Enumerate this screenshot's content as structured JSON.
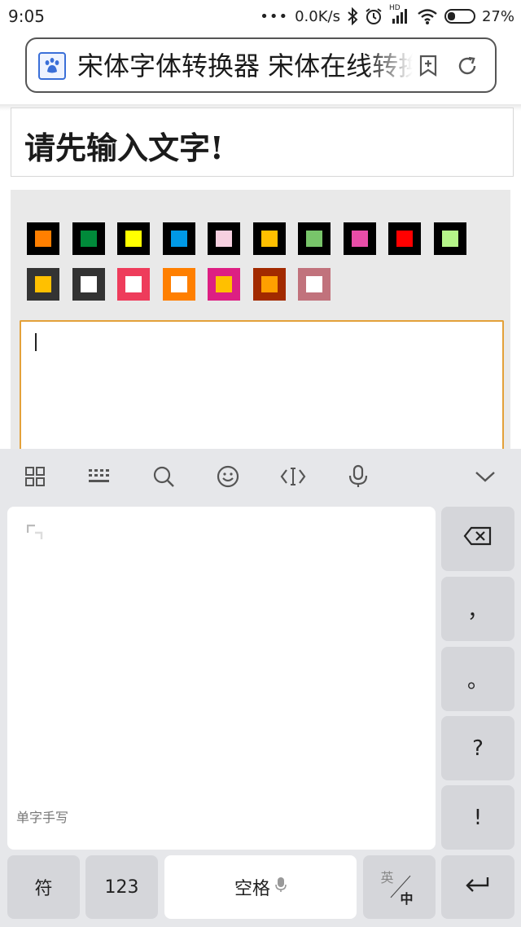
{
  "status_bar": {
    "time": "9:05",
    "network_speed": "0.0K/s",
    "battery_percent": "27%",
    "hd_label": "HD",
    "battery_level": 0.27
  },
  "browser": {
    "page_title": "宋体字体转换器 宋体在线转换器",
    "icons": [
      "paw-icon",
      "bookmark-add-icon",
      "refresh-icon"
    ]
  },
  "page": {
    "notice": "请先输入文字!",
    "swatches": [
      {
        "border": "#000000",
        "fill": "#ff7f00"
      },
      {
        "border": "#000000",
        "fill": "#008a3a"
      },
      {
        "border": "#000000",
        "fill": "#ffff00"
      },
      {
        "border": "#000000",
        "fill": "#0099e6"
      },
      {
        "border": "#000000",
        "fill": "#f6d0e0"
      },
      {
        "border": "#000000",
        "fill": "#ffc000"
      },
      {
        "border": "#000000",
        "fill": "#78c56a"
      },
      {
        "border": "#000000",
        "fill": "#e84da8"
      },
      {
        "border": "#000000",
        "fill": "#ff0000"
      },
      {
        "border": "#000000",
        "fill": "#b5f589"
      },
      {
        "border": "#333333",
        "fill": "#ffc000"
      },
      {
        "border": "#333333",
        "fill": "#ffffff"
      },
      {
        "border": "#ee3c5b",
        "fill": "#ffffff"
      },
      {
        "border": "#ff7f00",
        "fill": "#ffffff"
      },
      {
        "border": "#dd1f83",
        "fill": "#ffc000"
      },
      {
        "border": "#a22a00",
        "fill": "#ffa000"
      },
      {
        "border": "#c1727c",
        "fill": "#ffffff"
      }
    ],
    "text_input_value": ""
  },
  "keyboard": {
    "toolbar_icons": [
      "grid-icon",
      "keyboard-icon",
      "search-icon",
      "emoji-icon",
      "cursor-icon",
      "microphone-icon",
      "chevron-down-icon"
    ],
    "handwriting_label": "单字手写",
    "side_keys": [
      "，",
      "。",
      "?",
      "!"
    ],
    "symbol_key": "符",
    "number_key": "123",
    "space_key": "空格",
    "lang_en": "英",
    "lang_zh": "中"
  }
}
